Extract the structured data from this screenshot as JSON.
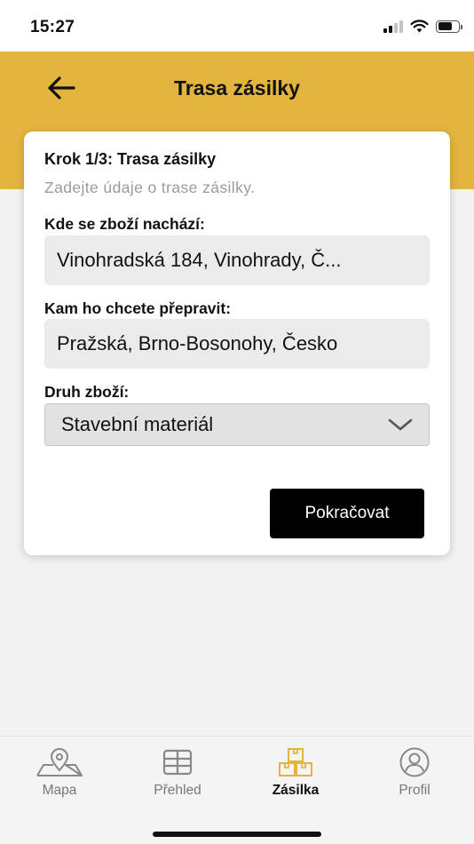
{
  "status_bar": {
    "time": "15:27"
  },
  "header": {
    "title": "Trasa zásilky"
  },
  "form": {
    "step_title": "Krok 1/3: Trasa zásilky",
    "step_subtitle": "Zadejte údaje o trase zásilky.",
    "origin_label": "Kde se zboží nachází:",
    "origin_value": "Vinohradská 184, Vinohrady, Č...",
    "destination_label": "Kam ho chcete přepravit:",
    "destination_value": "Pražská, Brno-Bosonohy, Česko",
    "goods_type_label": "Druh zboží:",
    "goods_type_value": "Stavební materiál",
    "continue_label": "Pokračovat"
  },
  "tabs": [
    {
      "label": "Mapa",
      "icon": "map-icon",
      "active": false
    },
    {
      "label": "Přehled",
      "icon": "grid-icon",
      "active": false
    },
    {
      "label": "Zásilka",
      "icon": "boxes-icon",
      "active": true
    },
    {
      "label": "Profil",
      "icon": "profile-icon",
      "active": false
    }
  ],
  "colors": {
    "accent": "#e3b43e",
    "primary_button": "#000000",
    "inactive_tab": "#777777"
  }
}
